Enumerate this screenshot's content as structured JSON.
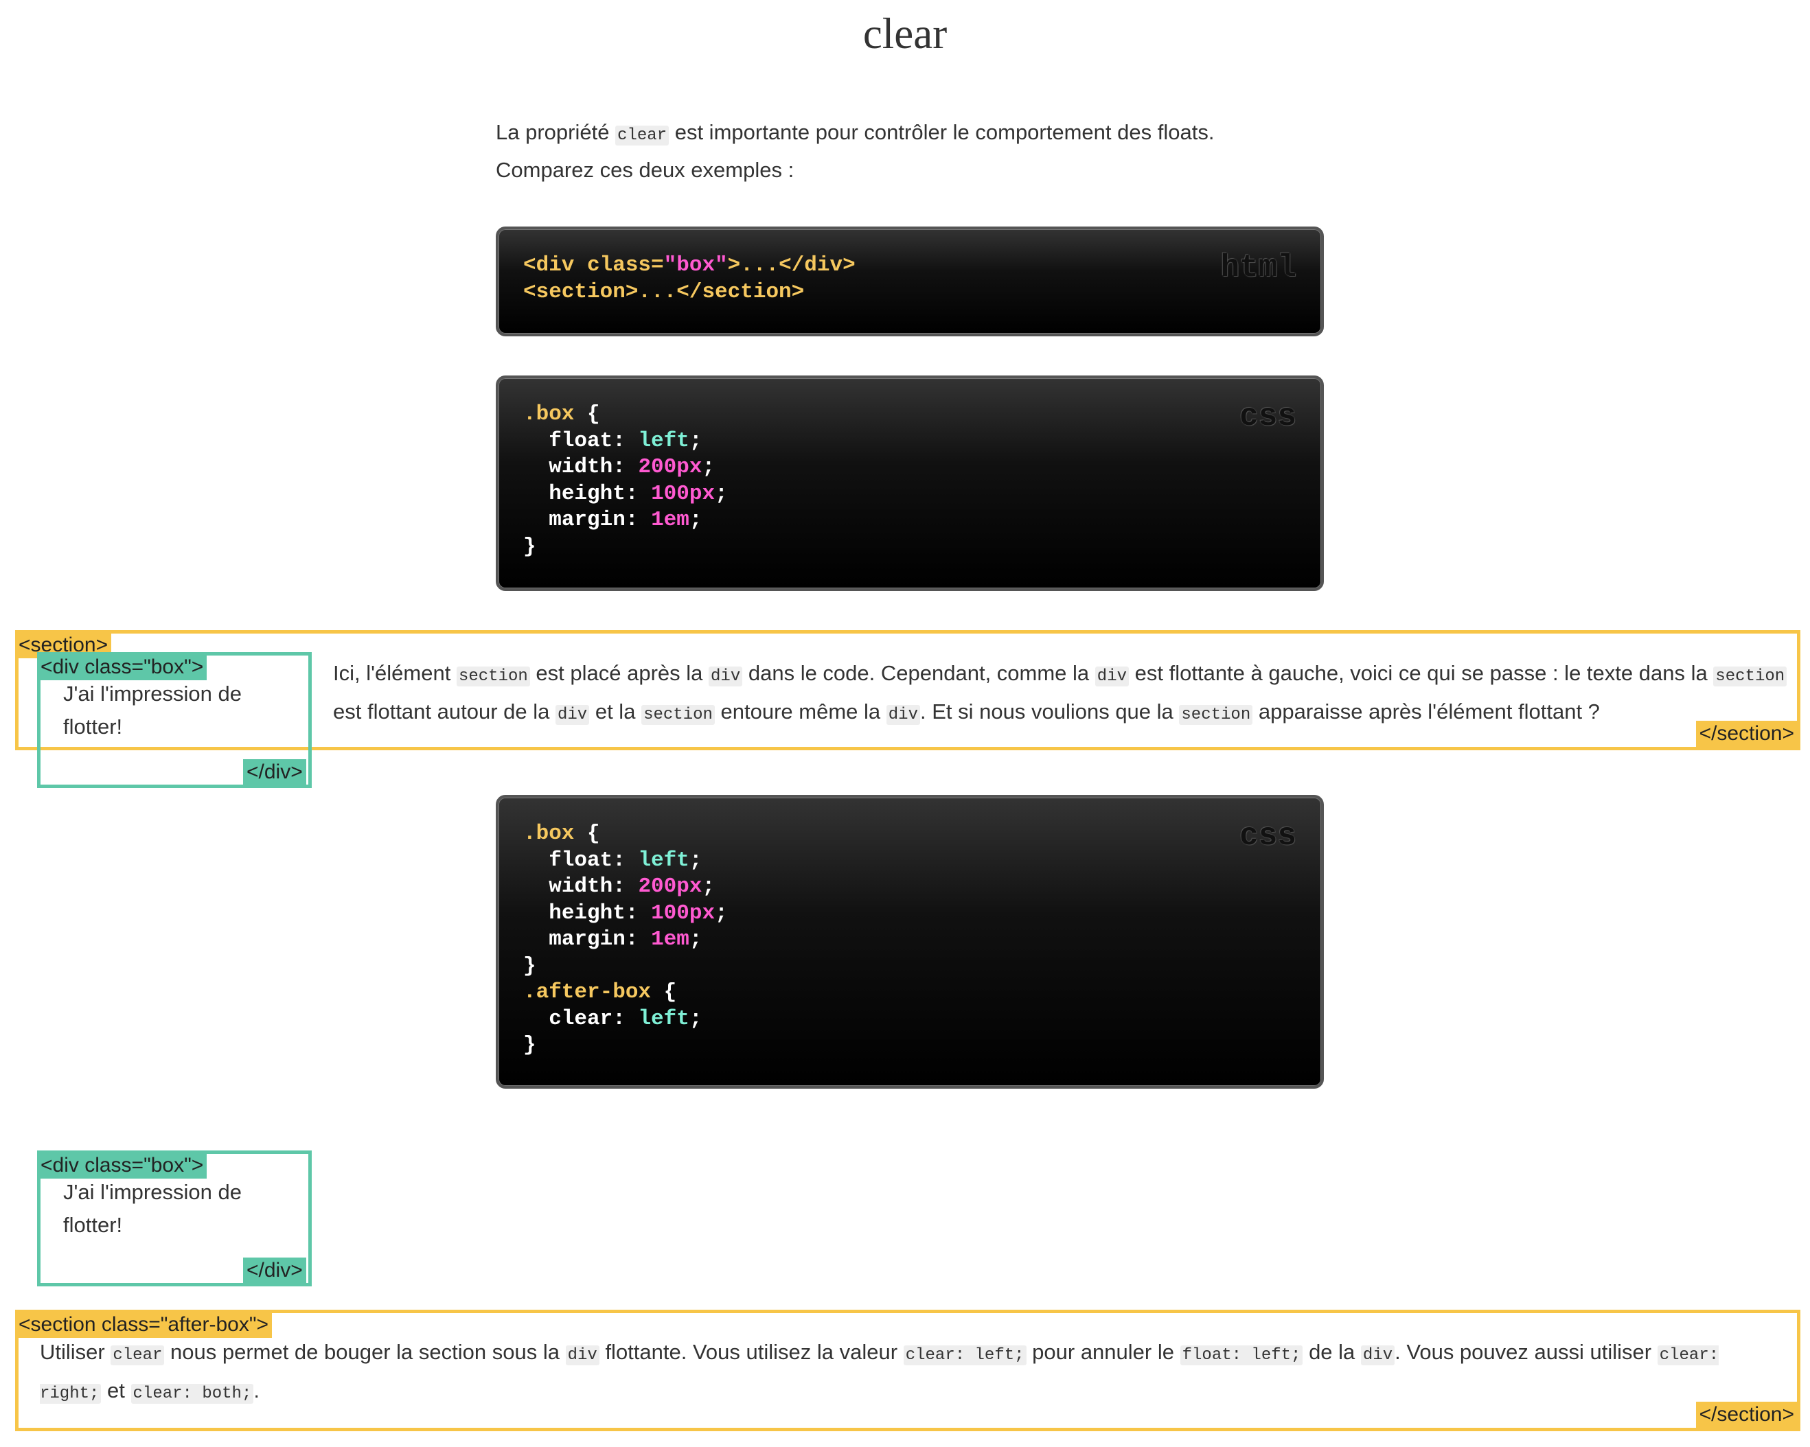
{
  "page": {
    "title": "clear"
  },
  "intro": {
    "line1_pre": "La propriété",
    "line1_code": "clear",
    "line1_post": "est importante pour contrôler le comportement des floats.",
    "line2": "Comparez ces deux exemples :"
  },
  "code_html": {
    "lang": "html",
    "line1_open": "<div class=",
    "line1_str": "\"box\"",
    "line1_close": ">...</div>",
    "line2": "<section>...</section>"
  },
  "code_css_1": {
    "lang": "css",
    "selector": ".box",
    "props": [
      {
        "name": "float",
        "value": "left",
        "kind": "kw"
      },
      {
        "name": "width",
        "value": "200px",
        "kind": "num"
      },
      {
        "name": "height",
        "value": "100px",
        "kind": "num"
      },
      {
        "name": "margin",
        "value": "1em",
        "kind": "num"
      }
    ]
  },
  "example1": {
    "section_open": "<section>",
    "section_close": "</section>",
    "div_open": "<div class=\"box\">",
    "div_close": "</div>",
    "box_text": "J'ai l'impression de flotter!",
    "text": {
      "s1": "Ici, l'élément",
      "c1": "section",
      "s2": "est placé après la",
      "c2": "div",
      "s3": "dans le code. Cependant, comme la",
      "c3": "div",
      "s4": "est flottante à gauche, voici ce qui se passe : le texte dans la",
      "c4": "section",
      "s5": "est flottant autour de la",
      "c5": "div",
      "s6": "et la",
      "c6": "section",
      "s7": "entoure même la",
      "c7": "div",
      "s8": ". Et si nous voulions que la",
      "c8": "section",
      "s9": "apparaisse après l'élément flottant ?"
    }
  },
  "code_css_2": {
    "lang": "css",
    "selector": ".box",
    "props": [
      {
        "name": "float",
        "value": "left",
        "kind": "kw"
      },
      {
        "name": "width",
        "value": "200px",
        "kind": "num"
      },
      {
        "name": "height",
        "value": "100px",
        "kind": "num"
      },
      {
        "name": "margin",
        "value": "1em",
        "kind": "num"
      }
    ],
    "selector2": ".after-box",
    "props2": [
      {
        "name": "clear",
        "value": "left",
        "kind": "kw"
      }
    ]
  },
  "example2": {
    "div_open": "<div class=\"box\">",
    "div_close": "</div>",
    "box_text": "J'ai l'impression de flotter!",
    "section_open": "<section class=\"after-box\">",
    "section_close": "</section>",
    "text": {
      "s1": "Utiliser",
      "c1": "clear",
      "s2": "nous permet de bouger la section sous la",
      "c2": "div",
      "s3": "flottante. Vous utilisez la valeur",
      "c3": "clear: left;",
      "s4": "pour annuler le",
      "c4": "float: left;",
      "s5": "de la",
      "c5": "div",
      "s6": ". Vous pouvez aussi utiliser",
      "c6": "clear: right;",
      "s7": "et",
      "c7": "clear: both;",
      "s8": "."
    }
  },
  "colors": {
    "section_outline": "#f7c548",
    "div_outline": "#5ec7a8",
    "code_selector": "#f6c85f",
    "code_number": "#ff5ad1",
    "code_keyword": "#7ff0d6"
  }
}
